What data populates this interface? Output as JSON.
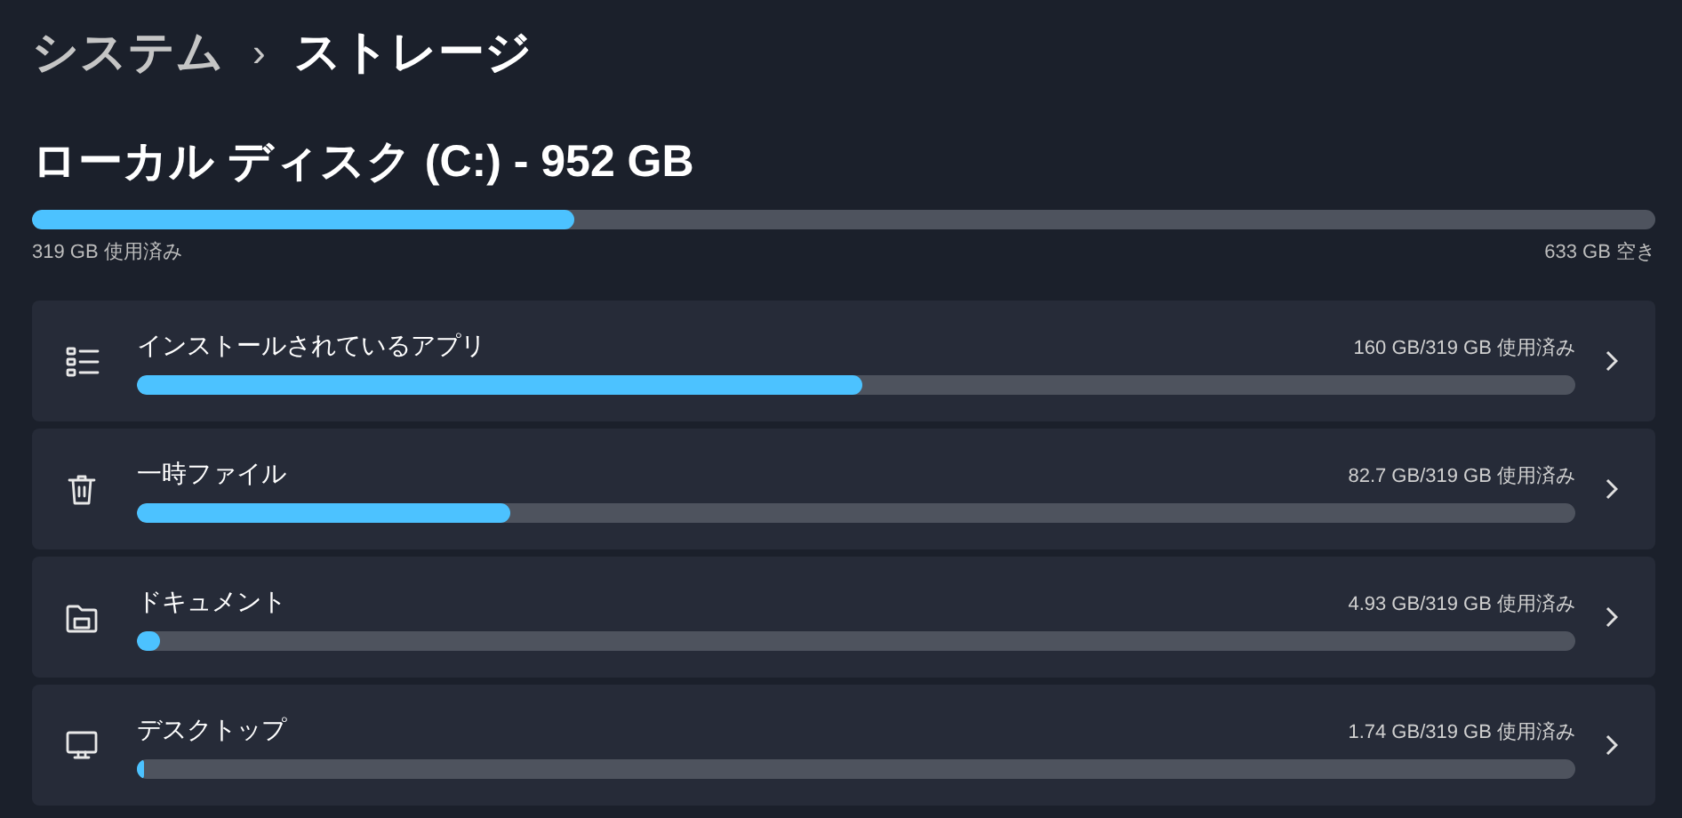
{
  "breadcrumb": [
    {
      "label": "システム",
      "current": false
    },
    {
      "label": "ストレージ",
      "current": true
    }
  ],
  "separator": "›",
  "disk": {
    "title": "ローカル ディスク (C:) - 952 GB",
    "level": 0.334,
    "used": "319 GB 使用済み",
    "free": "633 GB 空き"
  },
  "categories": [
    {
      "kind": "apps",
      "name": "インストールされているアプリ",
      "usage": "160 GB/319 GB 使用済み",
      "level": 0.504
    },
    {
      "kind": "temp",
      "name": "一時ファイル",
      "usage": "82.7 GB/319 GB 使用済み",
      "level": 0.26
    },
    {
      "kind": "documents",
      "name": "ドキュメント",
      "usage": "4.93 GB/319 GB 使用済み",
      "level": 0.016
    },
    {
      "kind": "desktop",
      "name": "デスクトップ",
      "usage": "1.74 GB/319 GB 使用済み",
      "level": 0.005
    }
  ]
}
